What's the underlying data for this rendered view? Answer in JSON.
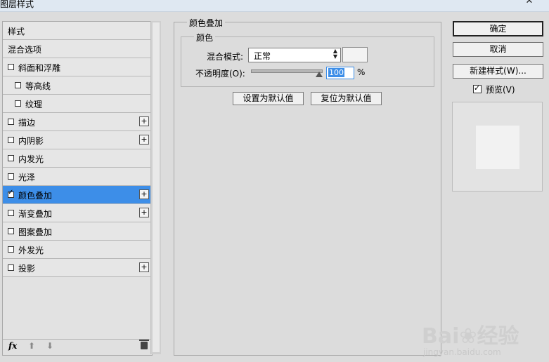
{
  "window": {
    "title": "图层样式",
    "close_glyph": "✕"
  },
  "styles_list": {
    "header": "样式",
    "blend_options": "混合选项",
    "items": [
      {
        "label": "斜面和浮雕",
        "checked": false,
        "indent": false,
        "plus": false
      },
      {
        "label": "等高线",
        "checked": false,
        "indent": true,
        "plus": false
      },
      {
        "label": "纹理",
        "checked": false,
        "indent": true,
        "plus": false
      },
      {
        "label": "描边",
        "checked": false,
        "indent": false,
        "plus": true
      },
      {
        "label": "内阴影",
        "checked": false,
        "indent": false,
        "plus": true
      },
      {
        "label": "内发光",
        "checked": false,
        "indent": false,
        "plus": false
      },
      {
        "label": "光泽",
        "checked": false,
        "indent": false,
        "plus": false
      },
      {
        "label": "颜色叠加",
        "checked": true,
        "indent": false,
        "plus": true,
        "selected": true
      },
      {
        "label": "渐变叠加",
        "checked": false,
        "indent": false,
        "plus": true
      },
      {
        "label": "图案叠加",
        "checked": false,
        "indent": false,
        "plus": false
      },
      {
        "label": "外发光",
        "checked": false,
        "indent": false,
        "plus": false
      },
      {
        "label": "投影",
        "checked": false,
        "indent": false,
        "plus": true
      }
    ],
    "plus_glyph": "+",
    "footer": {
      "fx": "fx",
      "up_glyph": "⬆",
      "down_glyph": "⬇"
    }
  },
  "settings": {
    "group_title": "颜色叠加",
    "sub_title": "颜色",
    "blend_mode_label": "混合模式:",
    "blend_mode_value": "正常",
    "opacity_label": "不透明度(O):",
    "opacity_value": "100",
    "opacity_unit": "%",
    "opacity_level": 1.0,
    "set_default_label": "设置为默认值",
    "reset_default_label": "复位为默认值"
  },
  "actions": {
    "ok": "确定",
    "cancel": "取消",
    "new_style": "新建样式(W)...",
    "preview_label": "预览(V)",
    "preview_checked": true
  },
  "watermark": {
    "line1": "Bai❀经验",
    "line2": "jingyan.baidu.com"
  },
  "colors": {
    "selected_row": "#3d8ee8",
    "dialog_bg": "#dcdcdc"
  }
}
